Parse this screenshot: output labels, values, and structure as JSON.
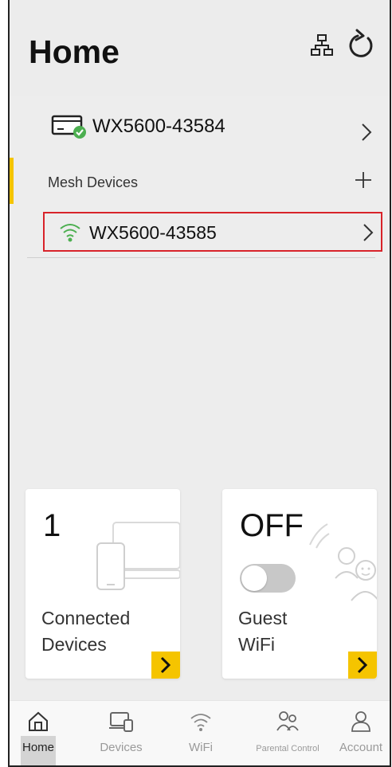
{
  "header": {
    "title": "Home"
  },
  "router": {
    "name": "WX5600-43584"
  },
  "mesh": {
    "section_label": "Mesh Devices",
    "items": [
      {
        "name": "WX5600-43585"
      }
    ]
  },
  "cards": {
    "connected": {
      "count": "1",
      "label_line1": "Connected",
      "label_line2": "Devices"
    },
    "guest": {
      "status": "OFF",
      "label_line1": "Guest",
      "label_line2": "WiFi",
      "enabled": false
    }
  },
  "tabs": [
    {
      "label": "Home",
      "icon": "home-icon",
      "active": true
    },
    {
      "label": "Devices",
      "icon": "devices-icon",
      "active": false
    },
    {
      "label": "WiFi",
      "icon": "wifi-icon",
      "active": false
    },
    {
      "label": "Parental Control",
      "icon": "parental-control-icon",
      "active": false
    },
    {
      "label": "Account",
      "icon": "account-icon",
      "active": false
    }
  ],
  "colors": {
    "accent": "#f5c400",
    "highlight_border": "#d8232a",
    "wifi_green": "#4caf50"
  }
}
